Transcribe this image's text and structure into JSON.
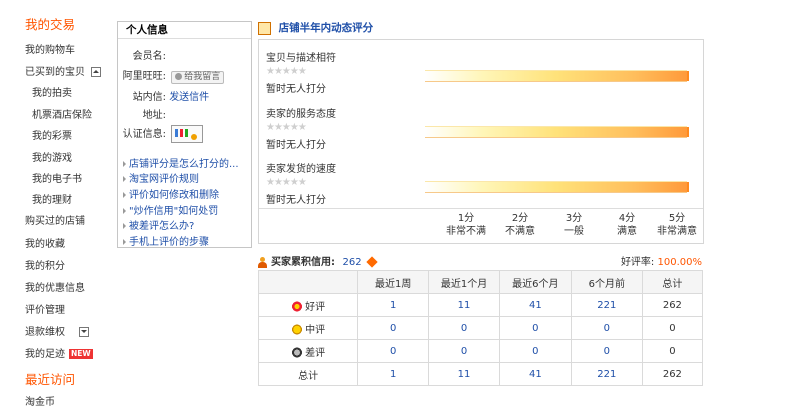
{
  "left_nav": {
    "section_title": "我的交易",
    "items": [
      "我的购物车",
      "已买到的宝贝",
      "我的拍卖",
      "机票酒店保险",
      "我的彩票",
      "我的游戏",
      "我的电子书",
      "我的理财",
      "购买过的店铺",
      "我的收藏",
      "我的积分",
      "我的优惠信息",
      "评价管理",
      "退款维权",
      "我的足迹"
    ],
    "new_badge": "NEW",
    "recent_title": "最近访问",
    "recent_items": [
      "淘金币"
    ]
  },
  "info_panel": {
    "title": "个人信息",
    "member_label": "会员名:",
    "wangwang_label": "阿里旺旺:",
    "leave_msg": "给我留言",
    "message_label": "站内信:",
    "message_link": "发送信件",
    "address_label": "地址:",
    "cert_label": "认证信息:",
    "links": [
      "店铺评分是怎么打分的...",
      "淘宝网评价规则",
      "评价如何修改和删除",
      "\"炒作信用\"如何处罚",
      "被差评怎么办?",
      "手机上评价的步骤"
    ]
  },
  "shop_rating": {
    "title": "店铺半年内动态评分",
    "items": [
      {
        "label": "宝贝与描述相符",
        "status": "暂时无人打分"
      },
      {
        "label": "卖家的服务态度",
        "status": "暂时无人打分"
      },
      {
        "label": "卖家发货的速度",
        "status": "暂时无人打分"
      }
    ],
    "stars": "★★★★★",
    "scale": [
      {
        "score": "1分",
        "desc": "非常不满"
      },
      {
        "score": "2分",
        "desc": "不满意"
      },
      {
        "score": "3分",
        "desc": "一般"
      },
      {
        "score": "4分",
        "desc": "满意"
      },
      {
        "score": "5分",
        "desc": "非常满意"
      }
    ]
  },
  "credit": {
    "title": "买家累积信用:",
    "score": "262",
    "rate_label": "好评率:",
    "rate_value": "100.00%",
    "headers": [
      "",
      "最近1周",
      "最近1个月",
      "最近6个月",
      "6个月前",
      "总计"
    ],
    "rows": [
      {
        "label": "好评",
        "icon": "good-face-icon",
        "values": [
          "1",
          "11",
          "41",
          "221",
          "262"
        ]
      },
      {
        "label": "中评",
        "icon": "neutral-face-icon",
        "values": [
          "0",
          "0",
          "0",
          "0",
          "0"
        ]
      },
      {
        "label": "差评",
        "icon": "bad-face-icon",
        "values": [
          "0",
          "0",
          "0",
          "0",
          "0"
        ]
      },
      {
        "label": "总计",
        "icon": "",
        "values": [
          "1",
          "11",
          "41",
          "221",
          "262"
        ]
      }
    ]
  }
}
